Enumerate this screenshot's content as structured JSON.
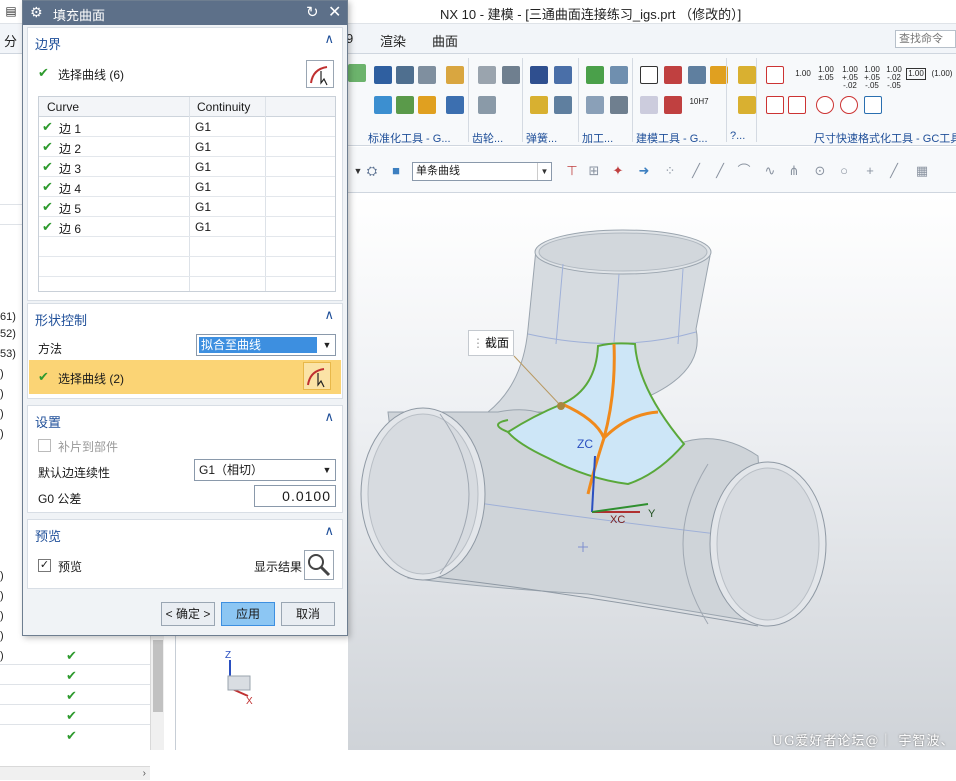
{
  "app": {
    "title": "NX 10 - 建模 - [三通曲面连接练习_igs.prt （修改的）]"
  },
  "menubar": {
    "left_partial": "分",
    "partial_9": "9",
    "items": [
      "渲染",
      "曲面"
    ],
    "search_placeholder": "查找命令"
  },
  "ribbon": {
    "groups": [
      "标准化工具 - G...",
      "齿轮...",
      "弹簧...",
      "加工...",
      "建模工具 - G...",
      "?...",
      "尺寸快速格式化工具 - GC工具"
    ],
    "tolerance_labels": [
      "1.00",
      "1.00 ±.05",
      "1.00 +.05 -.02",
      "1.00 +.05 -.05",
      "1.00 -.02 -.05",
      "1.00",
      "(1.00)"
    ],
    "small_label": "10H7"
  },
  "toolbar": {
    "filter_value": "单条曲线"
  },
  "viewport": {
    "tooltip": "截面",
    "axis_zc": "ZC",
    "axis_xc": "XC",
    "axis_y": "Y",
    "tripod_z": "Z",
    "tripod_x": "X",
    "watermark": "UG爱好者论坛@｜ 宇智波、"
  },
  "leftnav": {
    "row_numbers": [
      "61)",
      "52)",
      "53)",
      ")",
      ")",
      ")",
      ")",
      ")",
      ")",
      ")",
      ")",
      ")"
    ]
  },
  "dialog": {
    "title": "填充曲面",
    "boundary": {
      "header": "边界",
      "select_label": "选择曲线 (6)",
      "columns": [
        "Curve",
        "Continuity"
      ],
      "rows": [
        {
          "curve": "边 1",
          "continuity": "G1"
        },
        {
          "curve": "边 2",
          "continuity": "G1"
        },
        {
          "curve": "边 3",
          "continuity": "G1"
        },
        {
          "curve": "边 4",
          "continuity": "G1"
        },
        {
          "curve": "边 5",
          "continuity": "G1"
        },
        {
          "curve": "边 6",
          "continuity": "G1"
        }
      ]
    },
    "shape": {
      "header": "形状控制",
      "method_label": "方法",
      "method_value": "拟合至曲线",
      "select_label": "选择曲线 (2)"
    },
    "settings": {
      "header": "设置",
      "patch_label": "补片到部件",
      "default_cont_label": "默认边连续性",
      "default_cont_value": "G1（相切）",
      "g0_label": "G0 公差",
      "g0_value": "0.0100"
    },
    "preview": {
      "header": "预览",
      "preview_label": "预览",
      "show_result_label": "显示结果"
    },
    "buttons": {
      "ok": "< 确定 >",
      "apply": "应用",
      "cancel": "取消"
    }
  },
  "colors": {
    "dialog_title_bg": "#5d7089",
    "section_header": "#1f4f99",
    "check_green": "#2e9a2e",
    "highlight_row": "#fbd475",
    "selection_blue": "#3d8fe0",
    "fill_surface": "#cde6f7",
    "edge_green": "#5aa83a",
    "section_orange": "#f08a1c"
  }
}
